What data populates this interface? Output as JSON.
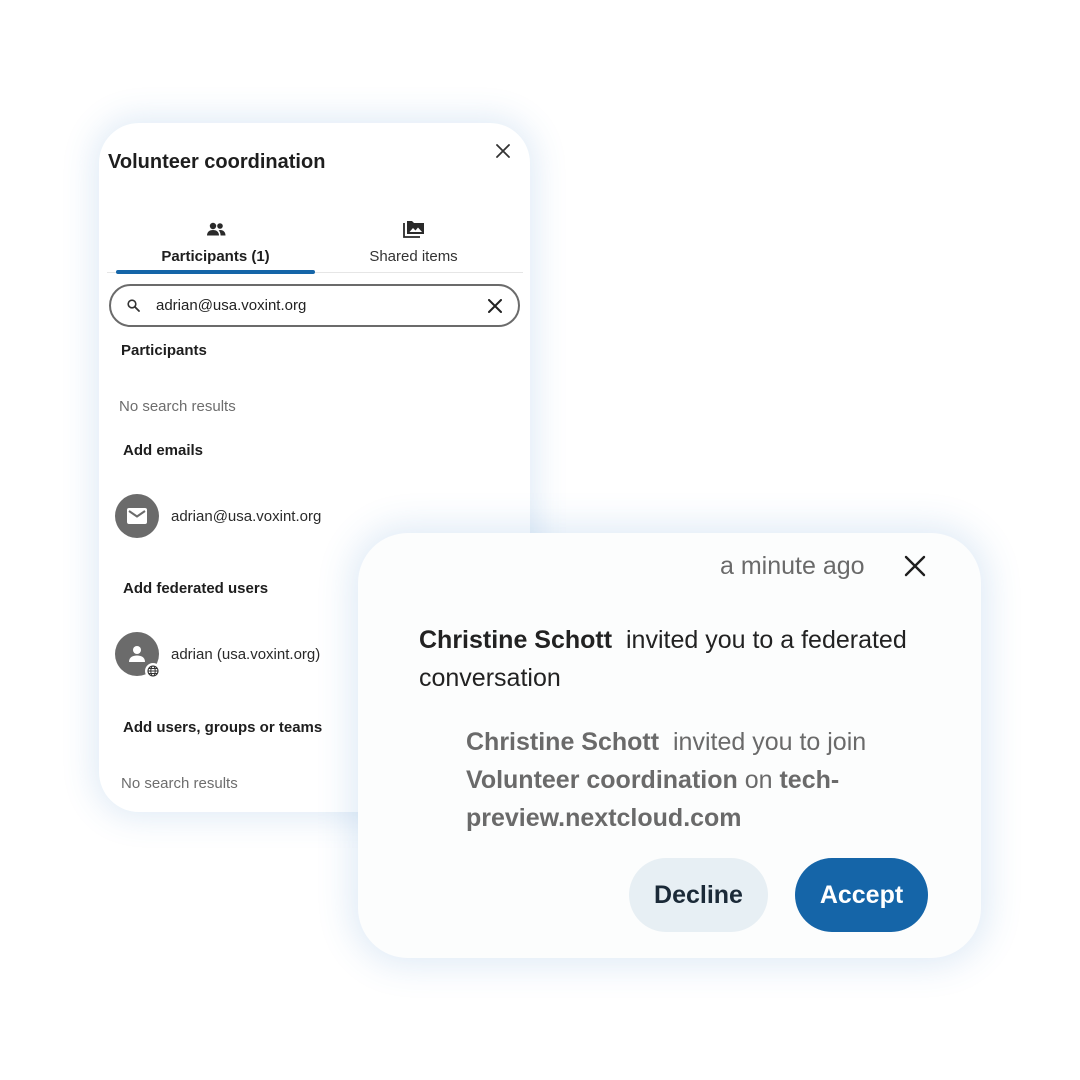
{
  "panel": {
    "title": "Volunteer coordination",
    "tabs": [
      {
        "label": "Participants (1)",
        "icon": "people-icon",
        "active": true
      },
      {
        "label": "Shared items",
        "icon": "folder-image-icon",
        "active": false
      }
    ],
    "search": {
      "value": "adrian@usa.voxint.org",
      "placeholder": ""
    },
    "sections": {
      "participants": {
        "title": "Participants",
        "empty": "No search results"
      },
      "emails": {
        "title": "Add emails",
        "result": "adrian@usa.voxint.org",
        "avatar_icon": "mail-icon"
      },
      "federated": {
        "title": "Add federated users",
        "result": "adrian (usa.voxint.org)",
        "avatar_icon": "person-icon",
        "badge_icon": "globe-icon"
      },
      "users": {
        "title": "Add users, groups or teams",
        "empty": "No search results"
      }
    }
  },
  "notification": {
    "time": "a minute ago",
    "actor": "Christine Schott",
    "message": "invited you to a federated conversation",
    "detail": {
      "actor": "Christine Schott",
      "text": "invited you to join",
      "conversation": "Volunteer coordination",
      "on": "on",
      "server": "tech-preview.nextcloud.com"
    },
    "decline_label": "Decline",
    "accept_label": "Accept"
  },
  "colors": {
    "accent": "#1565a8",
    "decline_bg": "#e7eff4",
    "avatar_bg": "#6b6b6b",
    "muted_text": "#6d6d6d"
  }
}
